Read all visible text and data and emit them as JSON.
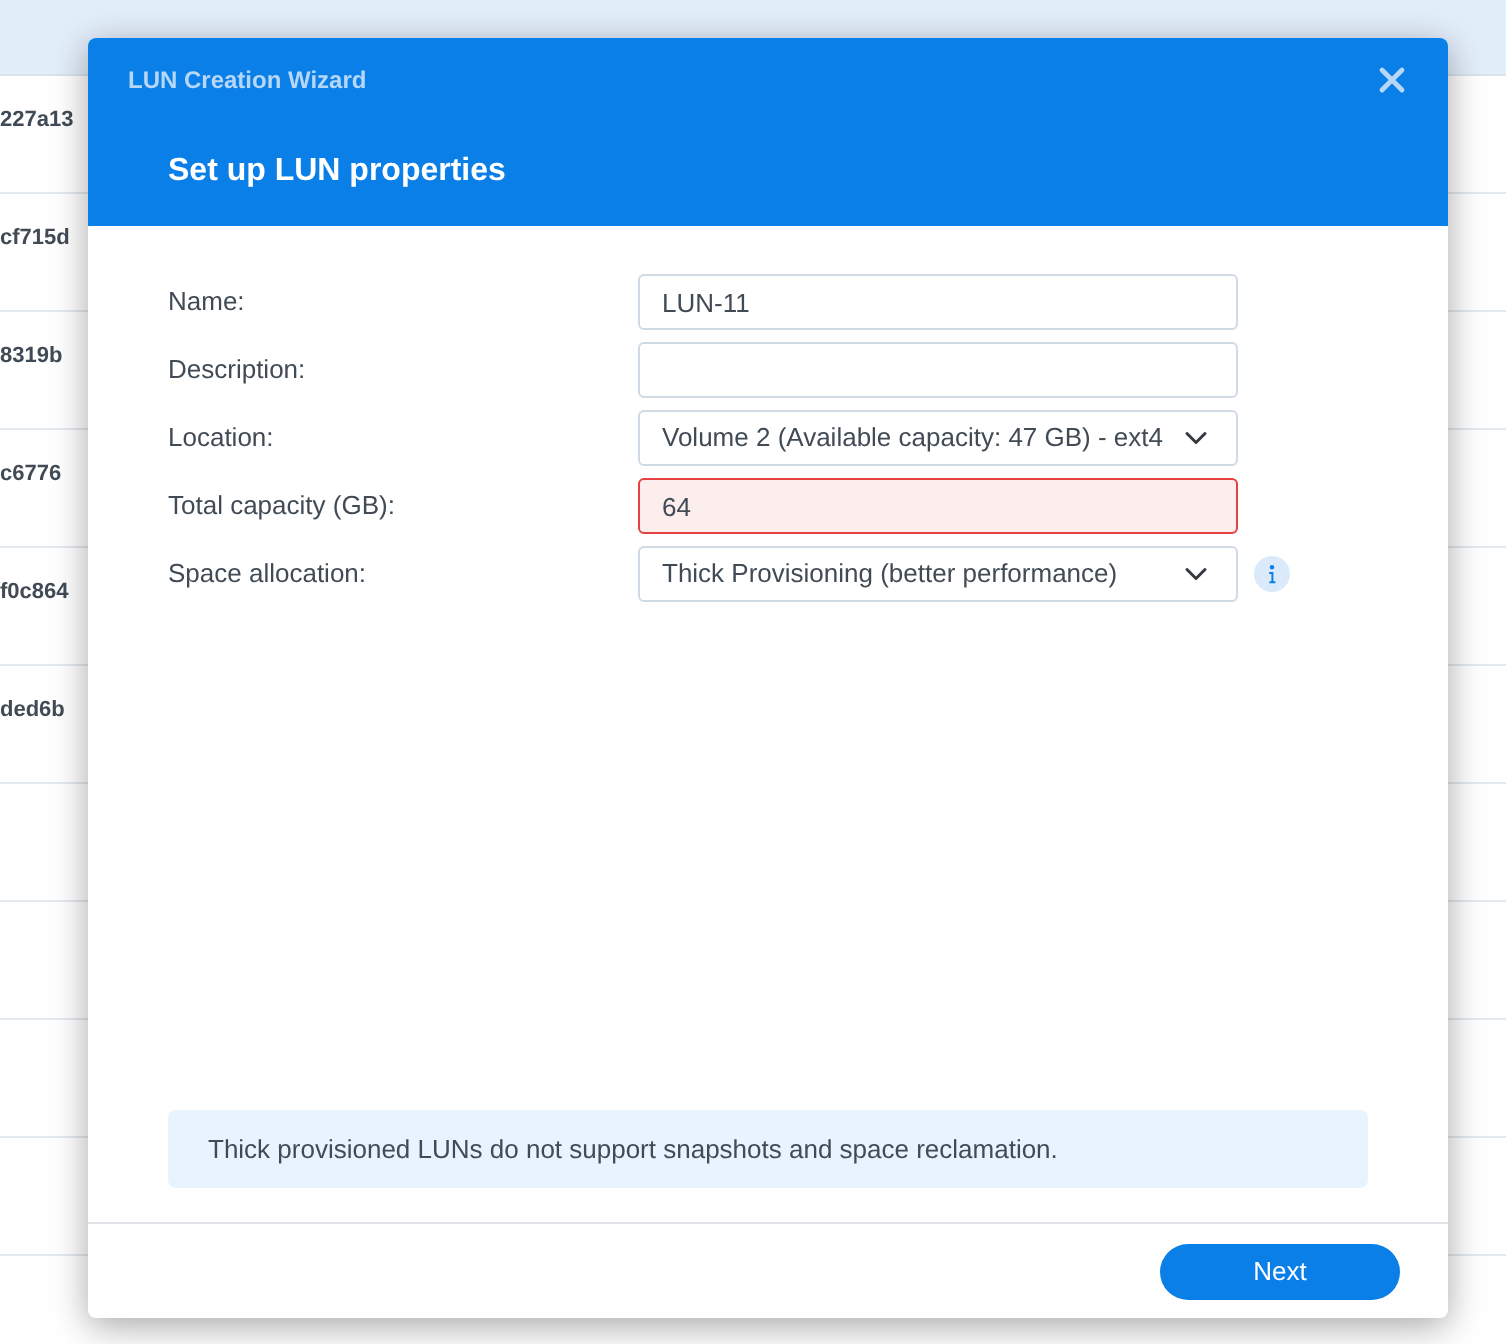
{
  "background_table": {
    "rows": [
      {
        "cell": "227a13"
      },
      {
        "cell": "cf715d"
      },
      {
        "cell": "8319b"
      },
      {
        "cell": "c6776"
      },
      {
        "cell": "f0c864"
      },
      {
        "cell": "ded6b"
      },
      {},
      {},
      {},
      {}
    ]
  },
  "dialog": {
    "title": "LUN Creation Wizard",
    "heading": "Set up LUN properties",
    "fields": [
      {
        "label": "Name:",
        "kind": "text",
        "value": "LUN-11",
        "invalid": false,
        "info": false
      },
      {
        "label": "Description:",
        "kind": "text",
        "invalid": false,
        "info": false
      },
      {
        "label": "Location:",
        "kind": "select",
        "value": "Volume 2 (Available capacity: 47 GB) - ext4",
        "invalid": false,
        "info": false
      },
      {
        "label": "Total capacity (GB):",
        "kind": "text",
        "value": "64",
        "invalid": true,
        "info": false
      },
      {
        "label": "Space allocation:",
        "kind": "select",
        "value": "Thick Provisioning (better performance)",
        "invalid": false,
        "info": true
      }
    ],
    "note": "Thick provisioned LUNs do not support snapshots and space reclamation.",
    "buttons": [
      {
        "label": "Next"
      }
    ]
  }
}
